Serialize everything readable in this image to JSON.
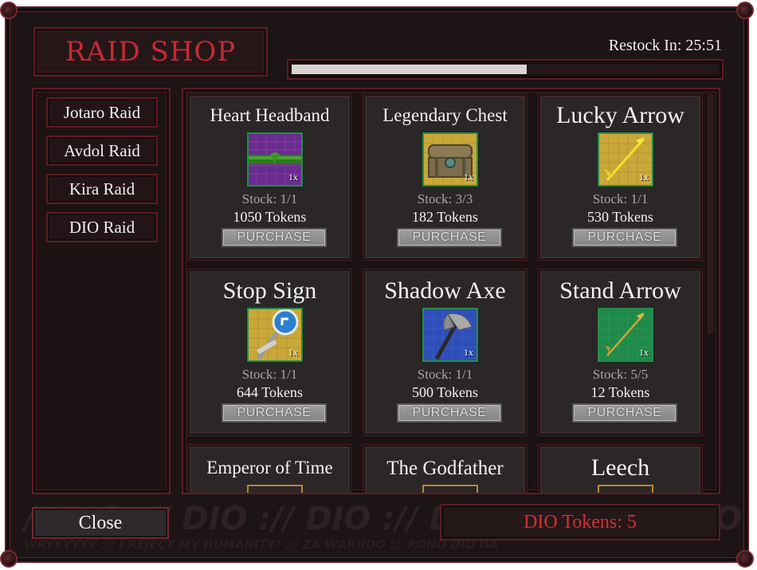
{
  "title": "RAID SHOP",
  "restock": {
    "label": "Restock In: 25:51",
    "progress": 0.55
  },
  "raids": [
    "Jotaro Raid",
    "Avdol Raid",
    "Kira Raid",
    "DIO Raid"
  ],
  "items": [
    {
      "name": "Heart Headband",
      "qty": "1x",
      "stock": "Stock: 1/1",
      "price": "1050 Tokens",
      "button": "PURCHASE",
      "icon": "headband-icon",
      "bg": "#6a2c8f"
    },
    {
      "name": "Legendary Chest",
      "qty": "1x",
      "stock": "Stock: 3/3",
      "price": "182 Tokens",
      "button": "PURCHASE",
      "icon": "chest-icon",
      "bg": "#c9a83a"
    },
    {
      "name": "Lucky Arrow",
      "qty": "1x",
      "stock": "Stock: 1/1",
      "price": "530 Tokens",
      "button": "PURCHASE",
      "icon": "golden-arrow-icon",
      "bg": "#c9a83a"
    },
    {
      "name": "Stop Sign",
      "qty": "1x",
      "stock": "Stock: 1/1",
      "price": "644 Tokens",
      "button": "PURCHASE",
      "icon": "stop-sign-icon",
      "bg": "#c9a83a"
    },
    {
      "name": "Shadow Axe",
      "qty": "1x",
      "stock": "Stock: 1/1",
      "price": "500 Tokens",
      "button": "PURCHASE",
      "icon": "axe-icon",
      "bg": "#2f4fb8"
    },
    {
      "name": "Stand Arrow",
      "qty": "1x",
      "stock": "Stock: 5/5",
      "price": "12 Tokens",
      "button": "PURCHASE",
      "icon": "arrow-icon",
      "bg": "#1f8a4a"
    }
  ],
  "partial_items": [
    "Emperor of Time",
    "The Godfather",
    "Leech"
  ],
  "watermark": {
    "line1": "// DIO :// DIO :// DIO :// DIO :// DIO :// DIO",
    "line2": "WRYYYYYY :// I REJECT MY HUMANITY! ://                                   ZA WARUDO :// KONO DIO DA"
  },
  "close_label": "Close",
  "tokens_label": "DIO Tokens: 5",
  "colors": {
    "accent_red": "#c62a33",
    "frame": "#5e1c22",
    "background": "#1d1416"
  }
}
